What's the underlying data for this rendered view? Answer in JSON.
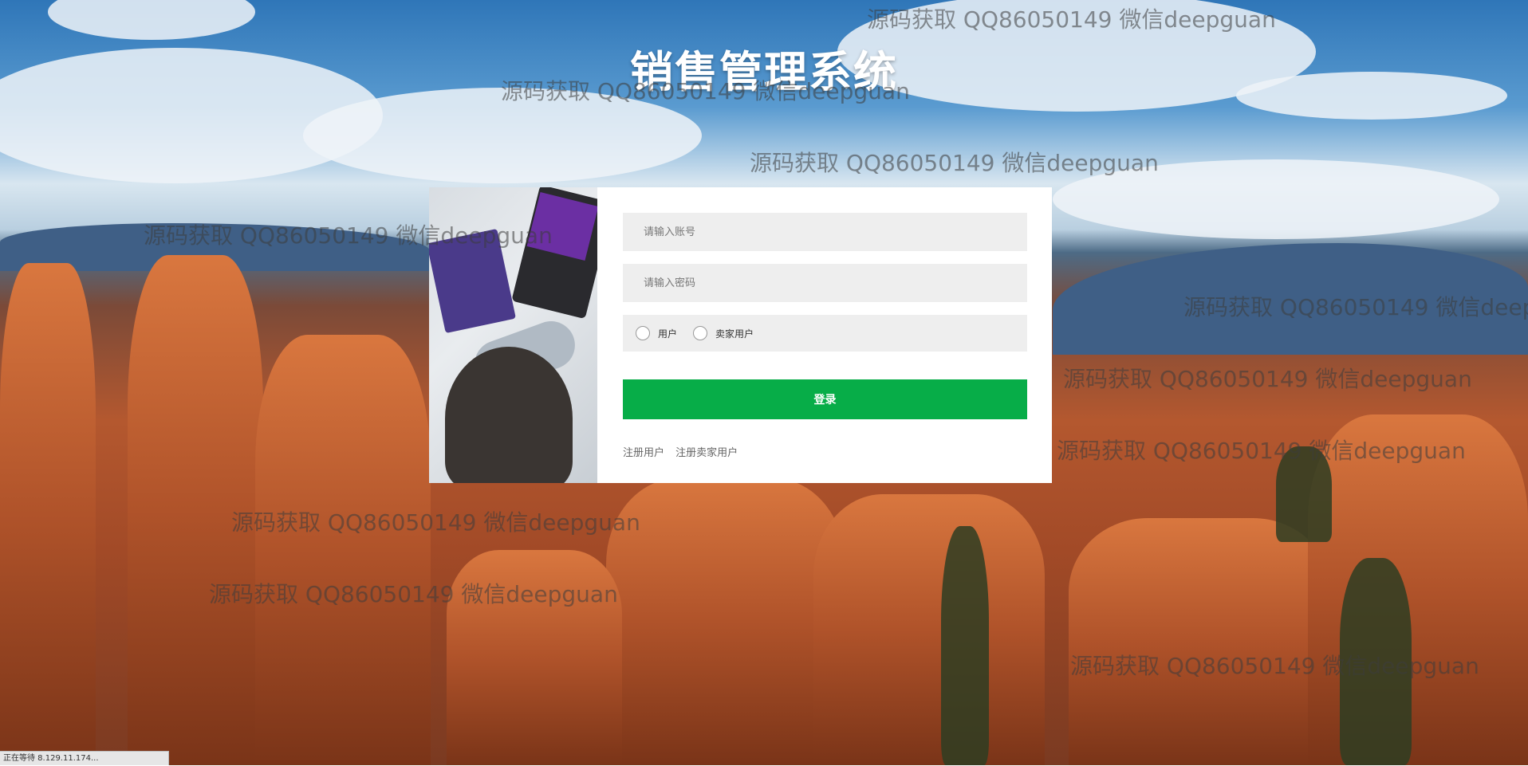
{
  "page": {
    "title": "销售管理系统"
  },
  "login": {
    "account_placeholder": "请输入账号",
    "password_placeholder": "请输入密码",
    "roles": [
      {
        "label": "用户"
      },
      {
        "label": "卖家用户"
      }
    ],
    "login_label": "登录",
    "register_user_label": "注册用户",
    "register_seller_label": "注册卖家用户"
  },
  "watermark": {
    "text": "源码获取 QQ86050149 微信deepguan"
  },
  "status": {
    "text": "正在等待 8.129.11.174..."
  },
  "colors": {
    "accent": "#07ad48",
    "field_bg": "#eeeeee",
    "panel_bg": "#ffffff"
  }
}
